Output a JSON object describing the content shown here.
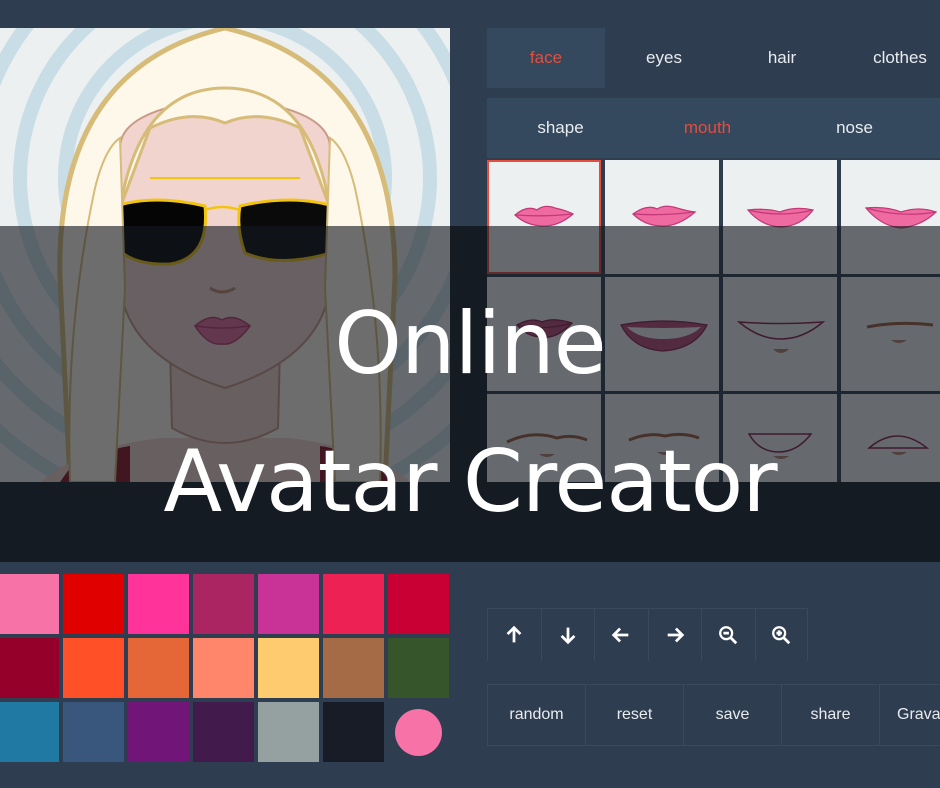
{
  "tabs": [
    {
      "label": "face",
      "active": true
    },
    {
      "label": "eyes",
      "active": false
    },
    {
      "label": "hair",
      "active": false
    },
    {
      "label": "clothes",
      "active": false
    }
  ],
  "subtabs": [
    {
      "label": "shape",
      "active": false
    },
    {
      "label": "mouth",
      "active": true
    },
    {
      "label": "nose",
      "active": false
    }
  ],
  "parts": {
    "selected_index": 0,
    "count": 12,
    "items": [
      "mouth-1",
      "mouth-2",
      "mouth-3",
      "mouth-4",
      "mouth-5",
      "mouth-6",
      "mouth-7",
      "mouth-8",
      "mouth-9",
      "mouth-10",
      "mouth-11",
      "mouth-12"
    ]
  },
  "left_toolbar": [
    "arrow-up-icon",
    "arrow-down-icon",
    "arrow-left-icon",
    "arrow-right-icon",
    "zoom-out-icon",
    "zoom-in-icon",
    "undo-icon",
    "redo-icon"
  ],
  "right_toolbar": [
    "arrow-up-icon",
    "arrow-down-icon",
    "arrow-left-icon",
    "arrow-right-icon",
    "zoom-out-icon",
    "zoom-in-icon"
  ],
  "swatches": [
    "#f672a7",
    "#e10000",
    "#ff3399",
    "#aa2561",
    "#c93397",
    "#ed2153",
    "#c80034",
    "#95002a",
    "#ff5027",
    "#e56637",
    "#ff866b",
    "#fecb6e",
    "#a56a46",
    "#36552b",
    "#1f79a3",
    "#39567c",
    "#721579",
    "#421a4b",
    "#95a0a1",
    "#181c26"
  ],
  "selected_color": "#f672a7",
  "actions": [
    "random",
    "reset",
    "save",
    "share",
    "Gravatar"
  ],
  "overlay_title": {
    "line1": "Online",
    "line2": "Avatar Creator"
  },
  "colors": {
    "accent": "#e74c3c",
    "background": "#2e3d50",
    "panel": "#34495e"
  }
}
